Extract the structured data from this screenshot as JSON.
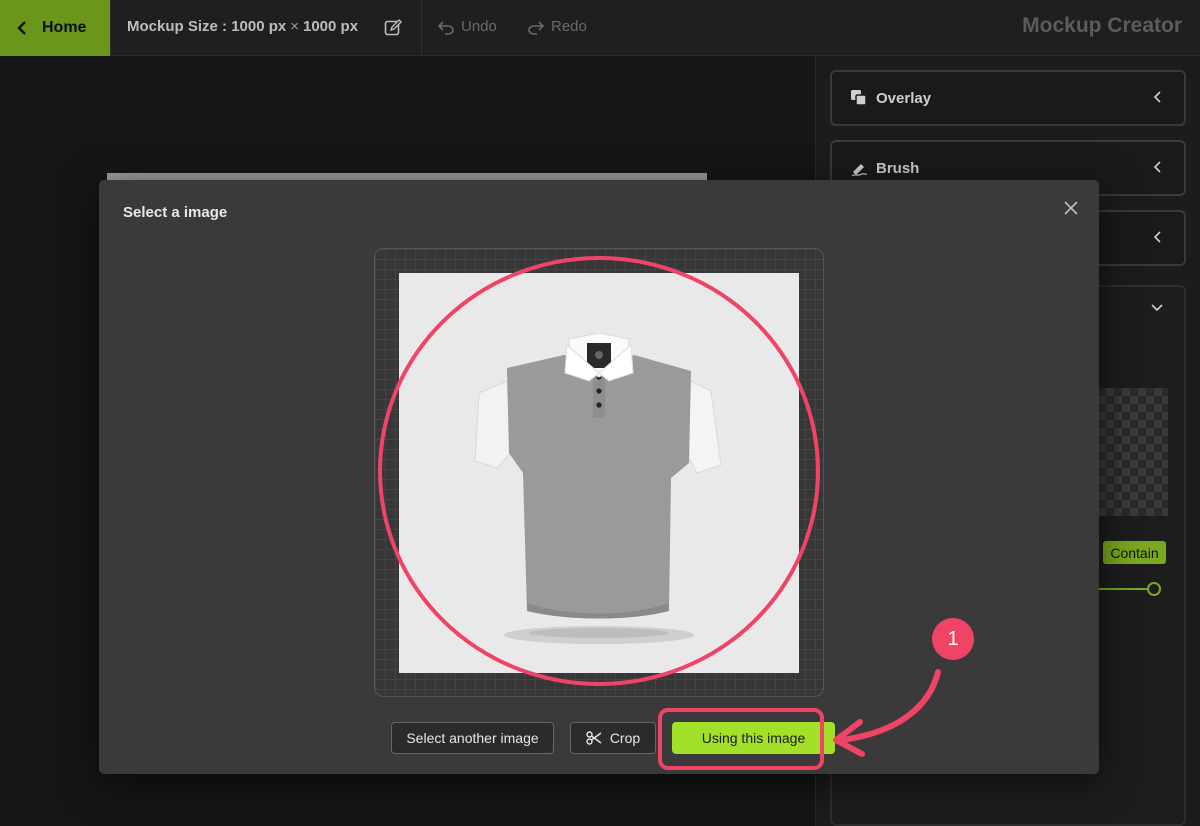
{
  "topbar": {
    "home_label": "Home",
    "size_prefix": "Mockup Size :",
    "width": "1000 px",
    "times": "×",
    "height": "1000 px",
    "undo_label": "Undo",
    "redo_label": "Redo",
    "app_title": "Mockup Creator"
  },
  "panel": {
    "items": [
      {
        "label": "Overlay",
        "icon": "layers-icon"
      },
      {
        "label": "Brush",
        "icon": "brush-icon"
      },
      {
        "label": "",
        "icon": ""
      }
    ],
    "contain_label": "Contain"
  },
  "modal": {
    "title": "Select a image",
    "select_another_label": "Select another image",
    "crop_label": "Crop",
    "use_label": "Using this image"
  },
  "annotation": {
    "step": "1",
    "color": "#f04467"
  },
  "colors": {
    "accent": "#a3e02a",
    "home_bg": "#6b961c"
  }
}
